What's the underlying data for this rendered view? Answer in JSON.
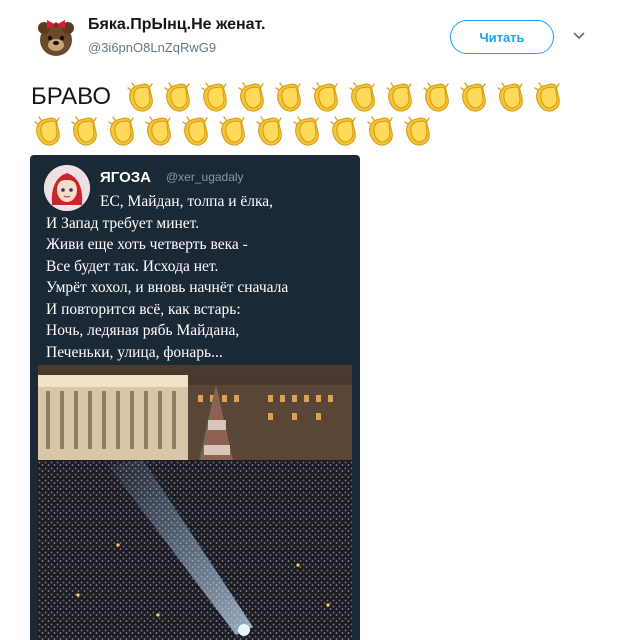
{
  "header": {
    "display_name": "Бяка.ПрЫнц.Не женат.",
    "handle": "@3i6pnO8LnZqRwG9",
    "follow_label": "Читать",
    "avatar_icon": "bear-with-bow-icon",
    "menu_icon": "chevron-down-icon"
  },
  "tweet": {
    "text": "БРАВО",
    "emoji_icon": "clapping-hands-icon",
    "emoji_count": 23
  },
  "quoted": {
    "display_name": "ЯГОЗА",
    "handle": "@xer_ugadaly",
    "avatar_icon": "red-haired-girl-icon",
    "poem_lines": [
      "ЕС, Майдан, толпа и ёлка,",
      "И Запад требует минет.",
      "Живи еще хоть четверть века -",
      "Все будет так. Исхода нет.",
      "Умрёт хохол, и вновь начнёт сначала",
      "И повторится всё, как встарь:",
      "Ночь, ледяная рябь Майдана,",
      "Печеньки, улица, фонарь..."
    ],
    "photo": "night-crowd-on-maidan-square-with-christmas-tree"
  },
  "colors": {
    "accent": "#1da1f2",
    "card_bg": "#1b2836",
    "handle_gray": "#657786"
  }
}
